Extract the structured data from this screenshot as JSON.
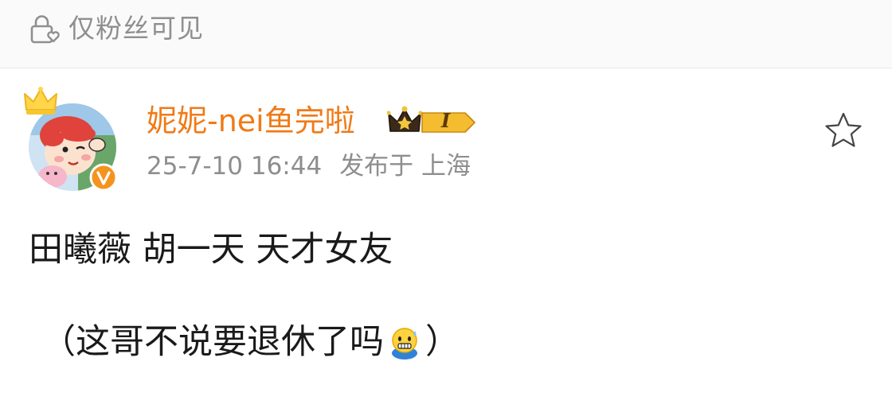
{
  "visibility": {
    "label": "仅粉丝可见",
    "icon": "lock-heart-icon"
  },
  "author": {
    "name": "妮妮-nei鱼完啦",
    "avatar": "crayon-shin-chan-avatar",
    "badges": [
      "crown-icon",
      "verified-icon",
      "vip-level-badge"
    ],
    "level_label": "I",
    "name_color": "#f07a16"
  },
  "meta": {
    "time": "25-7-10 16:44",
    "location": "发布于 上海"
  },
  "actions": {
    "favorite_icon": "star-icon"
  },
  "post": {
    "line1": "田曦薇 胡一天 天才女友",
    "line2_prefix": "（这哥不说要退休了吗",
    "line2_emoji": "nervous-sweat-emoji",
    "line2_suffix": "）"
  }
}
